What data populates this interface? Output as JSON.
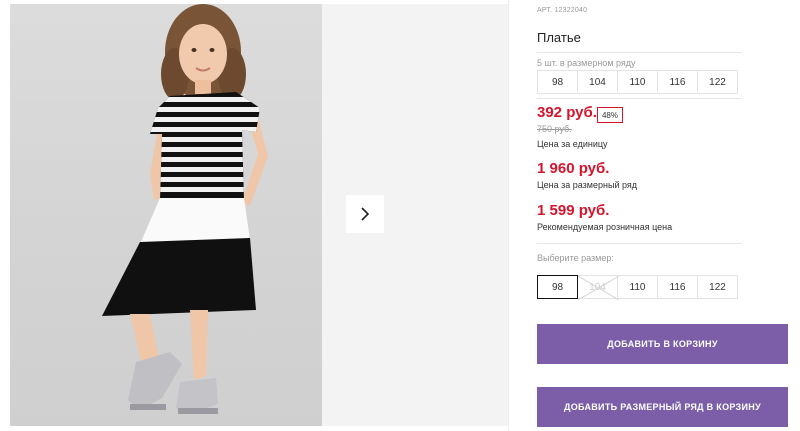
{
  "gallery": {
    "image_description_icon": "photo-girl-striped-dress",
    "next_icon": "chevron-right-icon"
  },
  "product": {
    "article": "АРТ. 12322040",
    "title": "Платье"
  },
  "size_row": {
    "note": "5 шт. в размерном ряду",
    "sizes": [
      "98",
      "104",
      "110",
      "116",
      "122"
    ]
  },
  "pricing": {
    "unit_price": "392 руб.",
    "discount": "48%",
    "old_price": "750 руб.",
    "unit_label": "Цена за единицу",
    "row_price": "1 960 руб.",
    "row_label": "Цена за размерный ряд",
    "rrp_price": "1 599 руб.",
    "rrp_label": "Рекомендуемая розничная цена"
  },
  "size_select": {
    "label": "Выберите размер:",
    "sizes": [
      "98",
      "104",
      "110",
      "116",
      "122"
    ],
    "selected": "98",
    "disabled": [
      "104"
    ]
  },
  "actions": {
    "add_to_cart": "ДОБАВИТЬ В КОРЗИНУ",
    "add_row_to_cart": "ДОБАВИТЬ РАЗМЕРНЫЙ РЯД В КОРЗИНУ"
  },
  "colors": {
    "accent": "#7b5ea7",
    "price_red": "#d4152c"
  }
}
